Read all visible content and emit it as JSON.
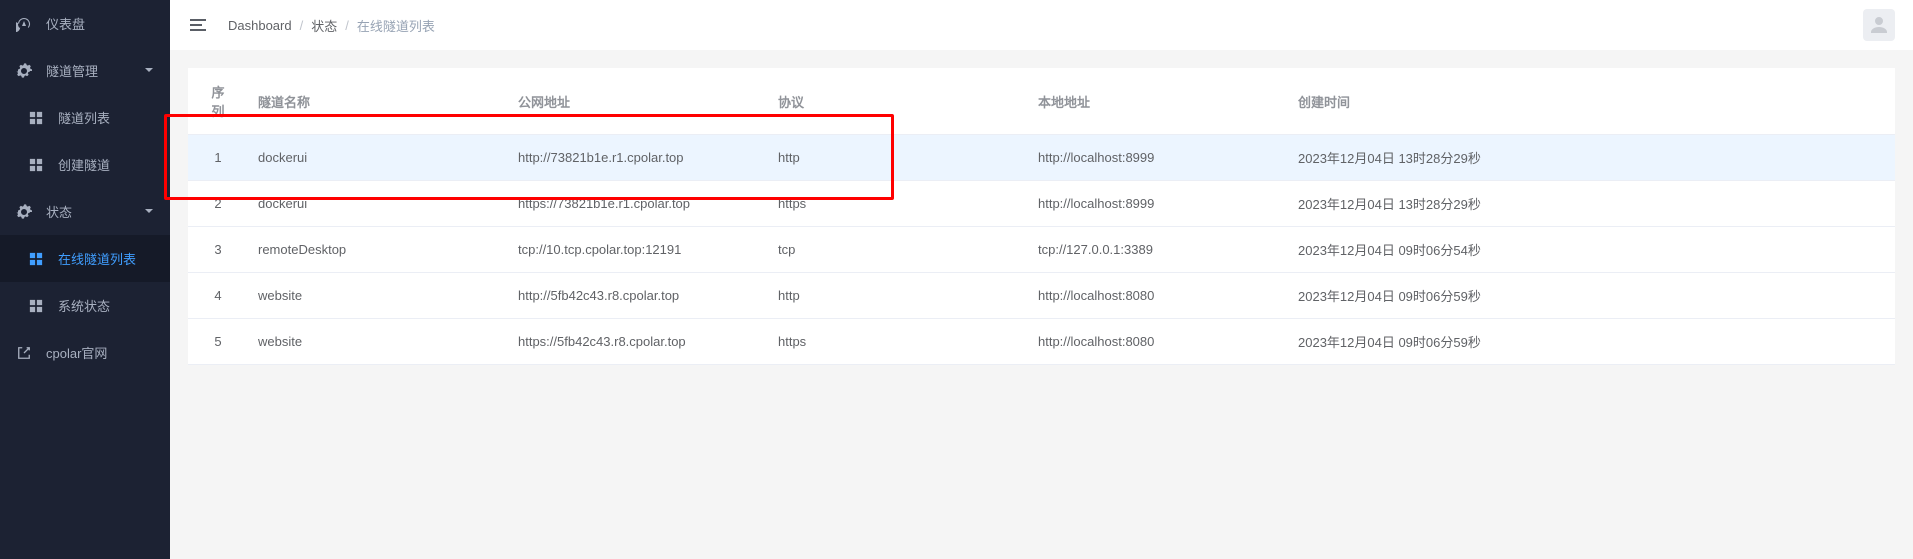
{
  "sidebar": {
    "items": [
      {
        "label": "仪表盘"
      },
      {
        "label": "隧道管理"
      },
      {
        "label": "隧道列表"
      },
      {
        "label": "创建隧道"
      },
      {
        "label": "状态"
      },
      {
        "label": "在线隧道列表"
      },
      {
        "label": "系统状态"
      },
      {
        "label": "cpolar官网"
      }
    ]
  },
  "breadcrumb": {
    "items": [
      "Dashboard",
      "状态",
      "在线隧道列表"
    ]
  },
  "table": {
    "headers": {
      "seq": "序列",
      "name": "隧道名称",
      "url": "公网地址",
      "proto": "协议",
      "local": "本地地址",
      "time": "创建时间"
    },
    "rows": [
      {
        "seq": "1",
        "name": "dockerui",
        "url": "http://73821b1e.r1.cpolar.top",
        "proto": "http",
        "local": "http://localhost:8999",
        "time": "2023年12月04日 13时28分29秒",
        "hl": true
      },
      {
        "seq": "2",
        "name": "dockerui",
        "url": "https://73821b1e.r1.cpolar.top",
        "proto": "https",
        "local": "http://localhost:8999",
        "time": "2023年12月04日 13时28分29秒",
        "hl": false
      },
      {
        "seq": "3",
        "name": "remoteDesktop",
        "url": "tcp://10.tcp.cpolar.top:12191",
        "proto": "tcp",
        "local": "tcp://127.0.0.1:3389",
        "time": "2023年12月04日 09时06分54秒",
        "hl": false
      },
      {
        "seq": "4",
        "name": "website",
        "url": "http://5fb42c43.r8.cpolar.top",
        "proto": "http",
        "local": "http://localhost:8080",
        "time": "2023年12月04日 09时06分59秒",
        "hl": false
      },
      {
        "seq": "5",
        "name": "website",
        "url": "https://5fb42c43.r8.cpolar.top",
        "proto": "https",
        "local": "http://localhost:8080",
        "time": "2023年12月04日 09时06分59秒",
        "hl": false
      }
    ]
  }
}
